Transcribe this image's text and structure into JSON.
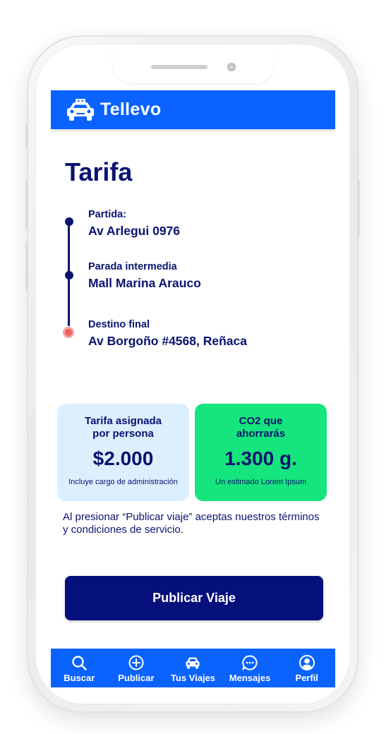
{
  "app": {
    "title": "Tellevo"
  },
  "page": {
    "title": "Tarifa"
  },
  "route": {
    "stops": [
      {
        "label": "Partida:",
        "value": "Av Arlegui 0976"
      },
      {
        "label": "Parada intermedia",
        "value": "Mall Marina Arauco"
      },
      {
        "label": "Destino final",
        "value": "Av Borgoño #4568, Reñaca"
      }
    ]
  },
  "cards": {
    "fare": {
      "title": "Tarifa asignada por persona",
      "value": "$2.000",
      "note": "Incluye cargo de administración"
    },
    "co2": {
      "title": "CO2 que ahorrarás",
      "value": "1.300 g.",
      "note": "Un estimado Lorem Ipsum"
    }
  },
  "terms": "Al presionar “Publicar viaje” aceptas nuestros términos y condiciones de servicio.",
  "actions": {
    "publish_label": "Publicar Viaje"
  },
  "nav": {
    "items": [
      {
        "label": "Buscar",
        "icon": "search-icon"
      },
      {
        "label": "Publicar",
        "icon": "plus-circle-icon"
      },
      {
        "label": "Tus Viajes",
        "icon": "car-icon"
      },
      {
        "label": "Mensajes",
        "icon": "chat-icon"
      },
      {
        "label": "Perfil",
        "icon": "profile-icon"
      }
    ]
  },
  "colors": {
    "brand_blue": "#0a63ff",
    "navy": "#0a1370",
    "button_navy": "#05107c",
    "fare_card_bg": "#dcefff",
    "co2_card_bg": "#15e57c",
    "destination_dot": "#f0645f"
  }
}
